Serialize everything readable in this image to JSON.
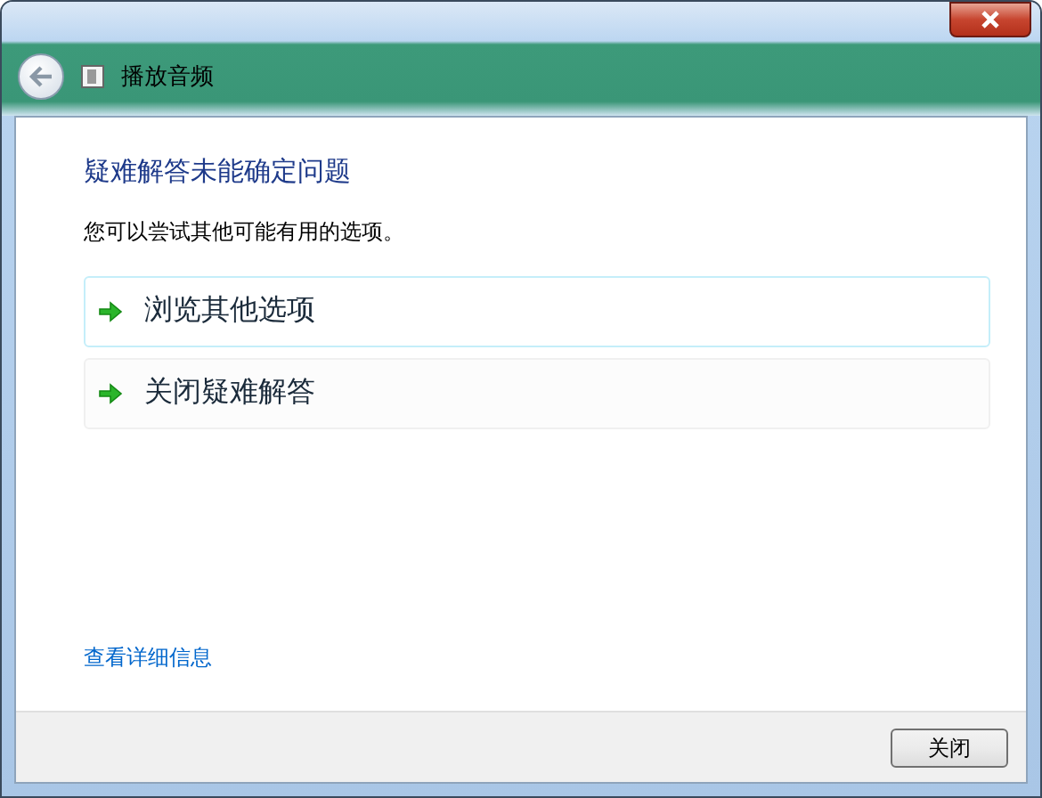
{
  "window": {
    "title": "播放音频"
  },
  "heading": "疑难解答未能确定问题",
  "description": "您可以尝试其他可能有用的选项。",
  "options": [
    {
      "label": "浏览其他选项",
      "highlighted": true
    },
    {
      "label": "关闭疑难解答",
      "highlighted": false
    }
  ],
  "details_link": "查看详细信息",
  "buttons": [
    "关闭"
  ]
}
